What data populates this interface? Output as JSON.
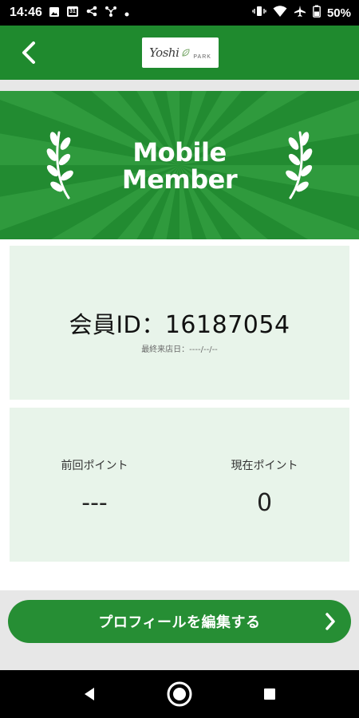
{
  "status_bar": {
    "time": "14:46",
    "calendar_day": "31",
    "battery": "50%",
    "left_icons": [
      "image-icon",
      "calendar-icon",
      "share-icon",
      "hub-icon",
      "dot-icon"
    ],
    "right_icons": [
      "vibrate-icon",
      "wifi-icon",
      "airplane-icon",
      "battery-icon"
    ]
  },
  "header": {
    "logo_main": "Yoshi",
    "logo_sub": "PARK"
  },
  "banner": {
    "title_line1": "Mobile",
    "title_line2": "Member"
  },
  "member_card": {
    "id_label": "会員ID：",
    "id_value": "16187054",
    "last_visit": "最終来店日：----/--/--"
  },
  "points": {
    "previous_label": "前回ポイント",
    "previous_value": "---",
    "current_label": "現在ポイント",
    "current_value": "0"
  },
  "actions": {
    "edit_profile_label": "プロフィールを編集する"
  },
  "colors": {
    "brand_green": "#1f8a2e",
    "card_bg": "#e8f4ea",
    "button_green": "#268e34"
  }
}
